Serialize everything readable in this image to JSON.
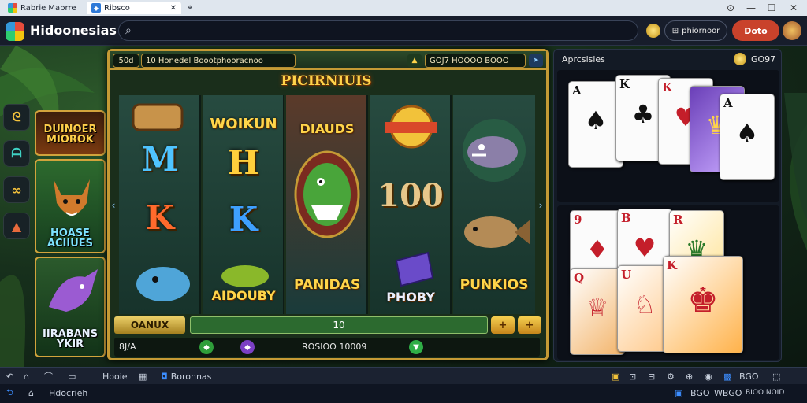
{
  "window": {
    "app_title": "Rabrie Mabrre",
    "tab_label": "Ribsco"
  },
  "topbar": {
    "logo_text": "Hidoonesias",
    "ph_button": "phiornoor",
    "done_button": "Doto"
  },
  "side_tiles": [
    {
      "label": "DUINOER MIOROK"
    },
    {
      "label": "HOASE ACIIUES"
    },
    {
      "label": "IIRABANS YKIR"
    }
  ],
  "slot": {
    "header_left_pill": "50d",
    "header_center_pill": "10 Honedel Boootphooracnoo",
    "header_right_pill": "GOJ7 HOOOO BOOO",
    "title": "PICIRNIUIS",
    "reels": [
      {
        "symbols": [
          "",
          "M",
          "K",
          ""
        ]
      },
      {
        "word": "WOIKUN",
        "symbols": [
          "H",
          "K"
        ],
        "bottom_word": "AIDOUBY"
      },
      {
        "word": "DIAUDS",
        "bottom_word": "PANIDAS"
      },
      {
        "number": "100",
        "bottom_word": "PHOBY"
      },
      {
        "bottom_word": "PUNKIOS"
      }
    ],
    "bet_label": "OANUX",
    "bet_value": "10",
    "plus_1": "+",
    "plus_2": "+",
    "status_left": "8J/A",
    "status_center": "ROSIOO 10009"
  },
  "cards": {
    "header_label": "Aprcsisies",
    "header_value": "GO97",
    "top_ranks": [
      "A",
      "K",
      "K",
      "",
      "A"
    ],
    "bottom_ranks": [
      "9",
      "B",
      "R",
      "Q",
      "U",
      "K"
    ]
  },
  "taskbar": {
    "item_1": "Hooie",
    "item_2": "Boronnas",
    "right_text": "BGO"
  },
  "navbar": {
    "label": "Hdocrieh",
    "right_1": "BGO",
    "right_2": "WBGO",
    "right_3": "BIOO NOID"
  },
  "colors": {
    "accent_gold": "#c59a35",
    "done_button": "#c9422b"
  }
}
